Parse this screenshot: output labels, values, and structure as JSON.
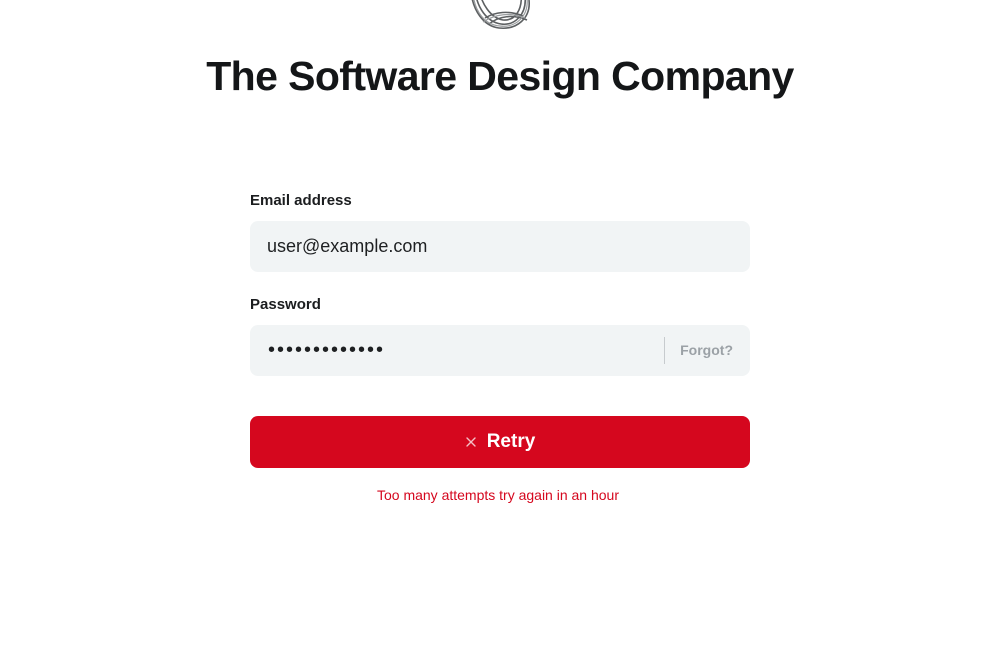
{
  "brand": {
    "title": "The Software Design Company",
    "logo_icon": "knot-logo-icon"
  },
  "form": {
    "email": {
      "label": "Email address",
      "value": "user@example.com"
    },
    "password": {
      "label": "Password",
      "masked_value": "•••••••••••••",
      "forgot_label": "Forgot?"
    },
    "submit": {
      "label": "Retry",
      "icon": "close-icon"
    },
    "error_message": "Too many attempts try again in an hour"
  },
  "colors": {
    "accent": "#d5071e",
    "field_bg": "#f1f4f5",
    "muted": "#9ba1a6"
  }
}
